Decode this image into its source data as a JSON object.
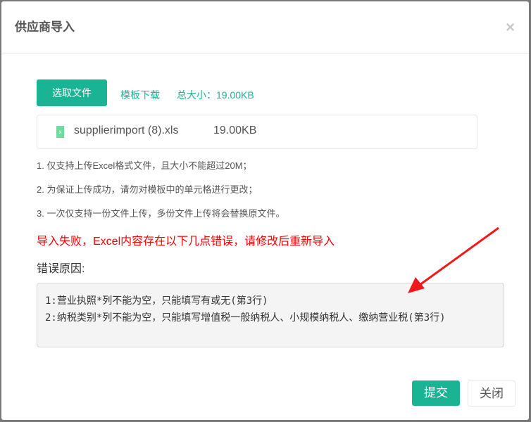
{
  "dialog": {
    "title": "供应商导入",
    "close_icon": "×"
  },
  "upload": {
    "pick_label": "选取文件",
    "template_label": "模板下载",
    "total_size": "总大小：19.00KB"
  },
  "file": {
    "name": "supplierimport (8).xls",
    "size": "19.00KB",
    "icon_glyph": "x"
  },
  "notes": [
    "1. 仅支持上传Excel格式文件，且大小不能超过20M；",
    "2. 为保证上传成功，请勿对模板中的单元格进行更改；",
    "3. 一次仅支持一份文件上传，多份文件上传将会替换原文件。"
  ],
  "error": {
    "message": "导入失败，Excel内容存在以下几点错误，请修改后重新导入",
    "reason_label": "错误原因:",
    "lines": [
      "1:营业执照*列不能为空，只能填写有或无(第3行)",
      "2:纳税类别*列不能为空，只能填写增值税一般纳税人、小规模纳税人、缴纳营业税(第3行)"
    ]
  },
  "footer": {
    "submit_label": "提交",
    "close_label": "关闭"
  },
  "colors": {
    "accent": "#1ab394",
    "error": "#ff0000"
  }
}
